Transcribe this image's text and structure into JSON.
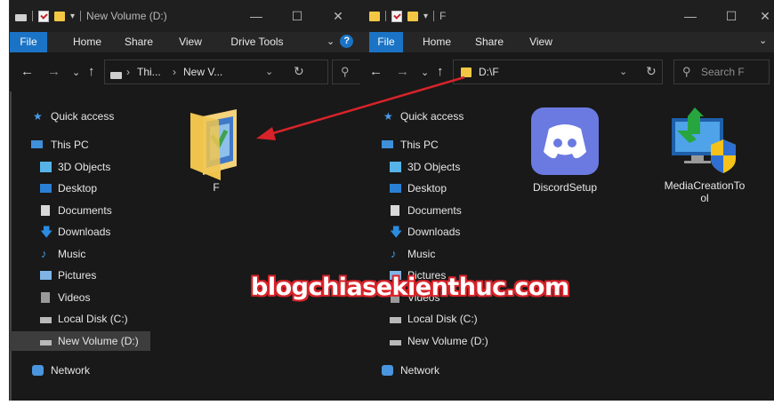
{
  "left": {
    "title": "New Volume (D:)",
    "tabs": [
      "File",
      "Home",
      "Share",
      "View",
      "Drive Tools"
    ],
    "help": "?",
    "address": [
      "Thi...",
      "New V..."
    ],
    "nav": [
      {
        "label": "Quick access",
        "icon": "star-icon"
      },
      {
        "label": "This PC",
        "icon": "pc-icon"
      },
      {
        "label": "3D Objects",
        "icon": "3d-objects-icon"
      },
      {
        "label": "Desktop",
        "icon": "desktop-icon"
      },
      {
        "label": "Documents",
        "icon": "documents-icon"
      },
      {
        "label": "Downloads",
        "icon": "downloads-icon"
      },
      {
        "label": "Music",
        "icon": "music-icon"
      },
      {
        "label": "Pictures",
        "icon": "pictures-icon"
      },
      {
        "label": "Videos",
        "icon": "videos-icon"
      },
      {
        "label": "Local Disk (C:)",
        "icon": "local-disk-icon"
      },
      {
        "label": "New Volume (D:)",
        "icon": "drive-icon"
      },
      {
        "label": "Network",
        "icon": "network-icon"
      }
    ],
    "files": [
      {
        "label": "F"
      }
    ]
  },
  "right": {
    "title": "F",
    "tabs": [
      "File",
      "Home",
      "Share",
      "View"
    ],
    "address": "D:\\F",
    "search_placeholder": "Search F",
    "nav": [
      {
        "label": "Quick access",
        "icon": "star-icon"
      },
      {
        "label": "This PC",
        "icon": "pc-icon"
      },
      {
        "label": "3D Objects",
        "icon": "3d-objects-icon"
      },
      {
        "label": "Desktop",
        "icon": "desktop-icon"
      },
      {
        "label": "Documents",
        "icon": "documents-icon"
      },
      {
        "label": "Downloads",
        "icon": "downloads-icon"
      },
      {
        "label": "Music",
        "icon": "music-icon"
      },
      {
        "label": "Pictures",
        "icon": "pictures-icon"
      },
      {
        "label": "Videos",
        "icon": "videos-icon"
      },
      {
        "label": "Local Disk (C:)",
        "icon": "local-disk-icon"
      },
      {
        "label": "New Volume (D:)",
        "icon": "drive-icon"
      },
      {
        "label": "Network",
        "icon": "network-icon"
      }
    ],
    "files": [
      {
        "label": "DiscordSetup"
      },
      {
        "label": "MediaCreationTo"
      },
      {
        "label": "ol"
      }
    ]
  },
  "watermark": "blogchiasekienthuc.com",
  "colors": {
    "accent": "#1b73c5",
    "arrow": "#d8232a",
    "folder": "#f3c744",
    "discord": "#6b7ae0"
  }
}
